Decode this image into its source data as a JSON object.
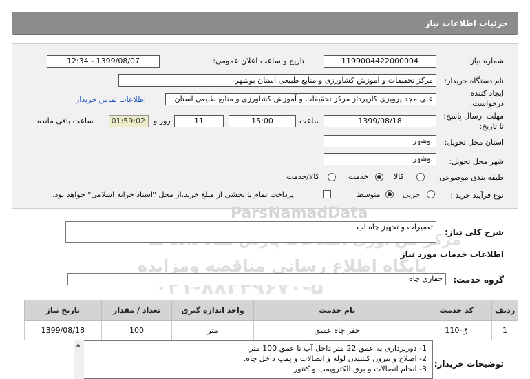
{
  "header": {
    "title": "جزئیات اطلاعات نیاز"
  },
  "form": {
    "need_number_label": "شماره نیاز:",
    "need_number": "1199004422000004",
    "announce_label": "تاریخ و ساعت اعلان عمومی:",
    "announce_value": "1399/08/07 - 12:34",
    "buyer_label": "نام دستگاه خریدار:",
    "buyer_value": "مرکز تحقیقات و آموزش کشاورزی و منابع طبیعی استان بوشهر",
    "creator_label_1": "ایجاد کننده",
    "creator_label_2": "درخواست:",
    "creator_value": "علی مجد پرویزی کارپرداز مرکز تحقیقات و آموزش کشاورزی و منابع طبیعی استان",
    "contact_link": "اطلاعات تماس خریدار",
    "deadline_label_1": "مهلت ارسال پاسخ:",
    "deadline_label_2": "تا تاریخ:",
    "deadline_date": "1399/08/18",
    "time_label": "ساعت",
    "deadline_time": "15:00",
    "days_value": "11",
    "days_label": "روز و",
    "remaining_time": "01:59:02",
    "remaining_label": "ساعت باقی مانده",
    "province_label": "استان محل تحویل:",
    "province_value": "بوشهر",
    "city_label": "شهر محل تحویل:",
    "city_value": "بوشهر",
    "category_label": "طبقه بندی موضوعی:",
    "category_options": [
      "کالا",
      "خدمت",
      "کالا/خدمت"
    ],
    "category_selected": "خدمت",
    "process_label": "نوع فرآیند خرید :",
    "process_options": [
      "جزیی",
      "متوسط"
    ],
    "process_selected": "متوسط",
    "payment_note": "پرداخت تمام یا بخشی از مبلغ خرید،از محل \"اسناد خزانه اسلامی\" خواهد بود."
  },
  "watermark": {
    "brand": "ParsNamadData",
    "line1": "مرکز فن آوری اطلاعات پارس نماد داده ها",
    "line2": "پایگاه اطلاع رسانی مناقصه ومزایده",
    "phone": "۰۲۱-۸۸۳۴۹۶۷۰-۵"
  },
  "summary": {
    "label": "شرح کلی نیاز:",
    "value": "تعمیرات و تجهیز چاه آب"
  },
  "services": {
    "section_title": "اطلاعات خدمات مورد نیاز",
    "group_label": "گروه خدمت:",
    "group_value": "حفاری چاه",
    "columns": [
      "ردیف",
      "کد خدمت",
      "نام خدمت",
      "واحد اندازه گیری",
      "تعداد / مقدار",
      "تاریخ نیاز"
    ],
    "rows": [
      [
        "1",
        "ق-110",
        "حفر چاه عمیق",
        "متر",
        "100",
        "1399/08/18"
      ]
    ]
  },
  "buyer_notes": {
    "label": "توضیحات خریدار:",
    "lines": [
      "1- دوربرداری به عمق 22 متر داخل آب تا عمق 100 متر.",
      "2- اصلاح و بیرون کشیدن لوله و اتصالات و پمپ داخل چاه.",
      "3- انجام اتصالات و برق الکتروپمپ و کنتور."
    ]
  }
}
